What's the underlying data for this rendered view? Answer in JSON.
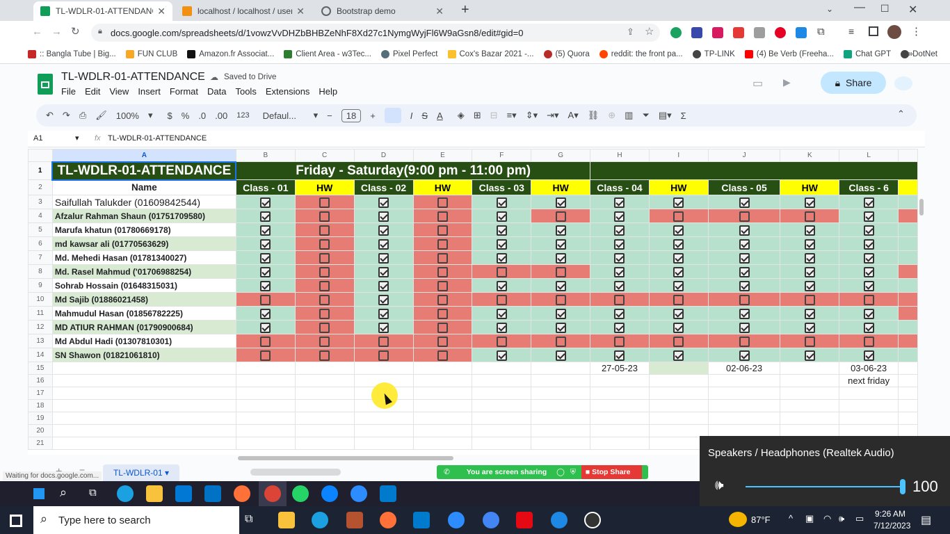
{
  "tabs": [
    {
      "label": "TL-WDLR-01-ATTENDANCE - G",
      "active": true,
      "color": "#0f9d58"
    },
    {
      "label": "localhost / localhost / user_ma",
      "active": false,
      "color": "#f29111"
    },
    {
      "label": "Bootstrap demo",
      "active": false,
      "color": "#5f6368"
    }
  ],
  "url": "docs.google.com/spreadsheets/d/1vowzVvDHZbBHBZeNhF8Xd27c1NymgWyjFl6W9aGsn8/edit#gid=0",
  "bookmarks": [
    {
      "label": ":: Bangla Tube | Big...",
      "color": "#c62828"
    },
    {
      "label": "FUN CLUB",
      "color": "#f9a825"
    },
    {
      "label": "Amazon.fr Associat...",
      "color": "#111111"
    },
    {
      "label": "Client Area - w3Tec...",
      "color": "#2e7d32"
    },
    {
      "label": "Pixel Perfect",
      "color": "#546e7a"
    },
    {
      "label": "Cox's Bazar 2021 -...",
      "color": "#fbc02d"
    },
    {
      "label": "(5) Quora",
      "color": "#b92b27"
    },
    {
      "label": "reddit: the front pa...",
      "color": "#ff4500"
    },
    {
      "label": "TP-LINK",
      "color": "#444444"
    },
    {
      "label": "(4) Be Verb (Freeha...",
      "color": "#ff0000"
    },
    {
      "label": "Chat GPT",
      "color": "#10a37f"
    },
    {
      "label": "DotNet",
      "color": "#444444"
    }
  ],
  "doc": {
    "title": "TL-WDLR-01-ATTENDANCE",
    "saved": "Saved to Drive",
    "share": "Share",
    "menus": [
      "File",
      "Edit",
      "View",
      "Insert",
      "Format",
      "Data",
      "Tools",
      "Extensions",
      "Help"
    ]
  },
  "toolbar": {
    "zoom": "100%",
    "currency": "$",
    "percent": "%",
    "dec_dec": ".0",
    "dec_inc": ".00",
    "format_123": "123",
    "font": "Defaul...",
    "size": "18"
  },
  "formula": {
    "cell": "A1",
    "fx": "fx",
    "content": "TL-WDLR-01-ATTENDANCE"
  },
  "columns": [
    "A",
    "B",
    "C",
    "D",
    "E",
    "F",
    "G",
    "H",
    "I",
    "J",
    "K",
    "L"
  ],
  "sheet": {
    "title": "TL-WDLR-01-ATTENDANCE",
    "banner": "Friday - Saturday(9:00 pm - 11:00 pm)",
    "name_header": "Name",
    "class_headers": [
      "Class - 01",
      "HW",
      "Class - 02",
      "HW",
      "Class - 03",
      "HW",
      "Class - 04",
      "HW",
      "Class - 05",
      "HW",
      "Class - 6"
    ],
    "rows": [
      {
        "name": "Saifullah Talukder (01609842544)",
        "checks": [
          1,
          0,
          1,
          0,
          1,
          1,
          1,
          1,
          1,
          1,
          1
        ],
        "extra": "g"
      },
      {
        "name": "Afzalur Rahman Shaun (01751709580)",
        "checks": [
          1,
          0,
          1,
          0,
          1,
          0,
          1,
          0,
          0,
          0,
          1
        ],
        "extra": "r"
      },
      {
        "name": "Marufa khatun (01780669178)",
        "checks": [
          1,
          0,
          1,
          0,
          1,
          1,
          1,
          1,
          1,
          1,
          1
        ],
        "extra": "g"
      },
      {
        "name": "md kawsar ali (01770563629)",
        "checks": [
          1,
          0,
          1,
          0,
          1,
          1,
          1,
          1,
          1,
          1,
          1
        ],
        "extra": "g"
      },
      {
        "name": "Md. Mehedi Hasan (01781340027)",
        "checks": [
          1,
          0,
          1,
          0,
          1,
          1,
          1,
          1,
          1,
          1,
          1
        ],
        "extra": "g"
      },
      {
        "name": "Md. Rasel Mahmud ('01706988254)",
        "checks": [
          1,
          0,
          1,
          0,
          0,
          0,
          1,
          1,
          1,
          1,
          1
        ],
        "extra": "r"
      },
      {
        "name": "Sohrab Hossain (01648315031)",
        "checks": [
          1,
          0,
          1,
          0,
          1,
          1,
          1,
          1,
          1,
          1,
          1
        ],
        "extra": "g"
      },
      {
        "name": "Md Sajib (01886021458)",
        "checks": [
          0,
          0,
          1,
          0,
          0,
          0,
          0,
          0,
          0,
          0,
          0
        ],
        "extra": "r"
      },
      {
        "name": "Mahmudul Hasan (01856782225)",
        "checks": [
          1,
          0,
          1,
          0,
          1,
          1,
          1,
          1,
          1,
          1,
          1
        ],
        "extra": "r"
      },
      {
        "name": "MD ATIUR RAHMAN (01790900684)",
        "checks": [
          1,
          0,
          1,
          0,
          1,
          1,
          1,
          1,
          1,
          1,
          1
        ],
        "extra": "g"
      },
      {
        "name": "Md Abdul Hadi (01307810301)",
        "checks": [
          0,
          0,
          0,
          0,
          0,
          0,
          0,
          0,
          0,
          0,
          0
        ],
        "extra": "r"
      },
      {
        "name": "SN Shawon (01821061810)",
        "checks": [
          0,
          0,
          0,
          0,
          1,
          1,
          1,
          1,
          1,
          1,
          1
        ],
        "extra": "g"
      }
    ],
    "date_row": {
      "H": "27-05-23",
      "J": "02-06-23",
      "L": "03-06-23"
    },
    "note_row": {
      "L": "next friday"
    },
    "row_numbers": [
      "1",
      "2",
      "3",
      "4",
      "5",
      "6",
      "7",
      "8",
      "9",
      "10",
      "11",
      "12",
      "13",
      "14",
      "15",
      "16",
      "17",
      "18",
      "19",
      "20",
      "21"
    ]
  },
  "sheet_tab": "TL-WDLR-01",
  "status": "Waiting for docs.google.com...",
  "screen_share": {
    "label": "You are screen sharing",
    "stop": "Stop Share"
  },
  "volume": {
    "device": "Speakers / Headphones (Realtek Audio)",
    "level": "100",
    "fraction": 1.0
  },
  "taskbar": {
    "search": "Type here to search",
    "temp": "87°F",
    "time": "9:26 AM",
    "date": "7/12/2023"
  }
}
